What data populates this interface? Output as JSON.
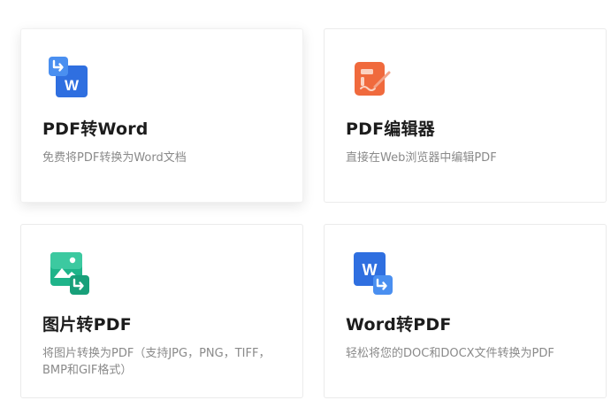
{
  "cards": [
    {
      "icon": "pdf-to-word-icon",
      "title": "PDF转Word",
      "desc": "免费将PDF转换为Word文档",
      "accent": "#2f6fe0"
    },
    {
      "icon": "pdf-editor-icon",
      "title": "PDF编辑器",
      "desc": "直接在Web浏览器中编辑PDF",
      "accent": "#f06a3d"
    },
    {
      "icon": "image-to-pdf-icon",
      "title": "图片转PDF",
      "desc": "将图片转换为PDF（支持JPG，PNG，TIFF，BMP和GIF格式）",
      "accent": "#1fb48a"
    },
    {
      "icon": "word-to-pdf-icon",
      "title": "Word转PDF",
      "desc": "轻松将您的DOC和DOCX文件转换为PDF",
      "accent": "#2f6fe0"
    }
  ],
  "icon_glyphs": {
    "word_letter": "W"
  }
}
